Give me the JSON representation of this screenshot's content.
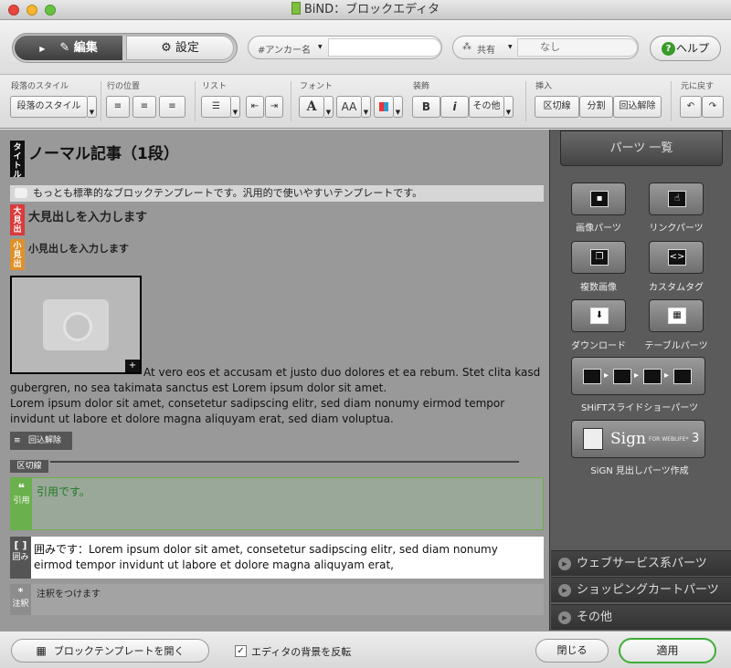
{
  "window": {
    "title": "BiND：ブロックエディタ"
  },
  "top": {
    "edit_label": "編集",
    "settings_label": "設定",
    "anchor_label": "#アンカー名",
    "anchor_value": "",
    "share_label": "共有",
    "share_value": "なし",
    "help_label": "ヘルプ"
  },
  "toolbar": {
    "groups": {
      "para_style": "段落のスタイル",
      "line_pos": "行の位置",
      "list": "リスト",
      "font": "フォント",
      "decoration": "装飾",
      "insert": "挿入",
      "undo": "元に戻す"
    },
    "para_style_value": "段落のスタイル",
    "other": "その他",
    "kugiri": "区切線",
    "bunkatsu": "分割",
    "kaijo": "回込解除",
    "bold": "B",
    "italic": "i",
    "font_a": "A",
    "font_aa": "AA"
  },
  "editor": {
    "title_tag": "タイトル",
    "title": "ノーマル記事（1段）",
    "lead": "もっとも標準的なブロックテンプレートです。汎用的で使いやすいテンプレートです。",
    "h2_tag": "大見出",
    "h2": "大見出しを入力します",
    "h3_tag": "小見出",
    "h3": "小見出しを入力します",
    "img_side_text": "At vero eos et accusam et justo duo dolores et ea rebum. Stet clita kasd",
    "para1": "gubergren, no sea takimata sanctus est Lorem ipsum dolor sit amet.",
    "para2": "Lorem ipsum dolor sit amet, consetetur sadipscing elitr, sed diam nonumy eirmod tempor",
    "para3": "invidunt ut labore et dolore magna aliquyam erat, sed diam voluptua.",
    "kaijo_label": "回込解除",
    "kugiri_label": "区切線",
    "quote_tag": "引用",
    "quote_text": "引用です。",
    "kakomi_tag": "囲み",
    "kakomi_line1": "囲みです：Lorem ipsum dolor sit amet, consetetur sadipscing elitr, sed diam nonumy",
    "kakomi_line2": "eirmod tempor invidunt ut labore et dolore magna aliquyam erat,",
    "chu_tag": "注釈",
    "chu_text": "注釈をつけます"
  },
  "parts": {
    "header": "パーツ 一覧",
    "image": "画像パーツ",
    "link": "リンクパーツ",
    "multi": "複数画像",
    "custom": "カスタムタグ",
    "download": "ダウンロード",
    "table": "テーブルパーツ",
    "slideshow": "SHiFTスライドショーパーツ",
    "sign_brand": "Sign",
    "sign_sub": "FOR WEBLIFE*",
    "sign_num": "3",
    "sign_label": "SiGN  見出しパーツ作成",
    "web": "ウェブサービス系パーツ",
    "cart": "ショッピングカートパーツ",
    "other": "その他"
  },
  "bottom": {
    "open_template": "ブロックテンプレートを開く",
    "invert_bg": "エディタの背景を反転",
    "close": "閉じる",
    "apply": "適用"
  }
}
